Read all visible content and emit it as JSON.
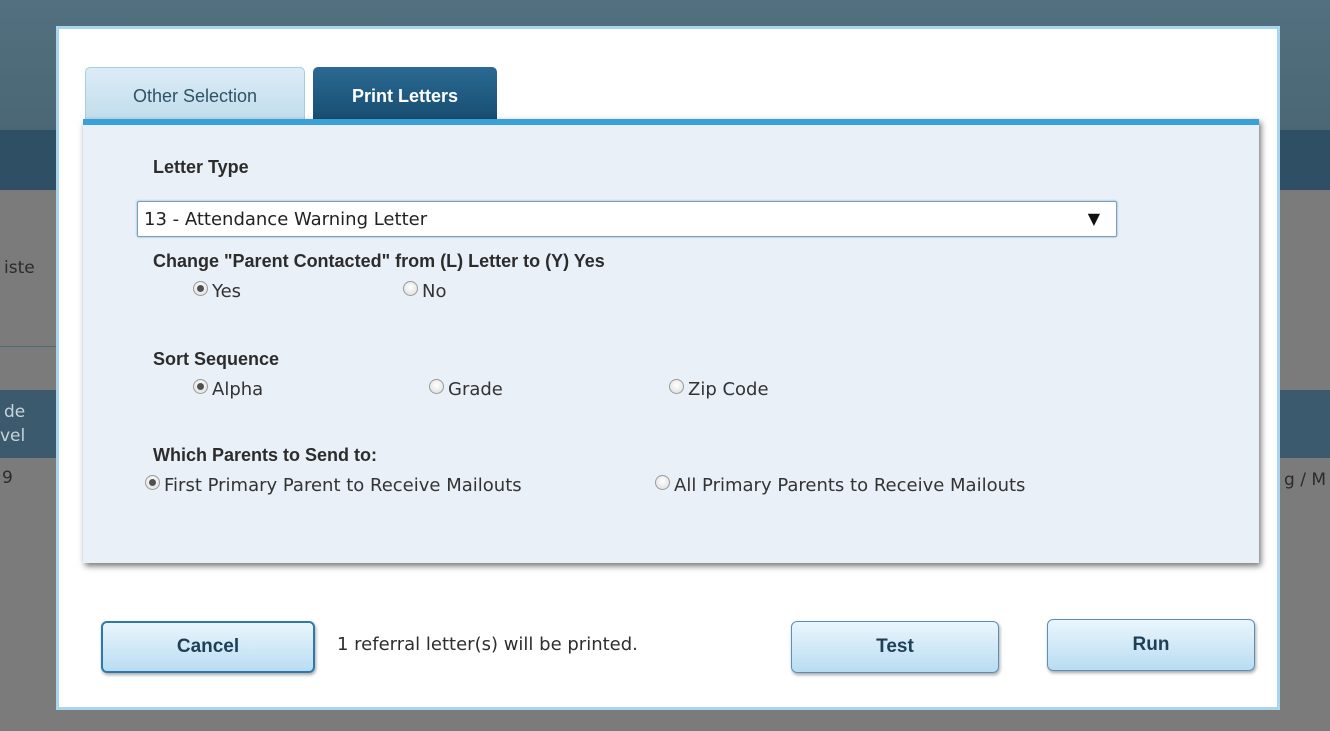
{
  "background": {
    "partial_texts": [
      "iste",
      "de",
      "vel",
      "9",
      "g / M"
    ]
  },
  "dialog": {
    "tabs": [
      {
        "label": "Other Selection"
      },
      {
        "label": "Print Letters"
      }
    ],
    "letter_type": {
      "label": "Letter Type",
      "selected": "13 - Attendance Warning Letter"
    },
    "parent_contacted": {
      "label": "Change \"Parent Contacted\" from (L) Letter to (Y) Yes",
      "options": [
        "Yes",
        "No"
      ],
      "selected": "Yes"
    },
    "sort_sequence": {
      "label": "Sort Sequence",
      "options": [
        "Alpha",
        "Grade",
        "Zip Code"
      ],
      "selected": "Alpha"
    },
    "which_parents": {
      "label": "Which Parents to Send to:",
      "options": [
        "First Primary Parent to Receive Mailouts",
        "All Primary Parents to Receive Mailouts"
      ],
      "selected": "First Primary Parent to Receive Mailouts"
    },
    "buttons": {
      "cancel": "Cancel",
      "test": "Test",
      "run": "Run"
    },
    "status": "1 referral letter(s) will be printed."
  },
  "colors": {
    "tab_active": "#1a5479",
    "panel_accent": "#3aa0d8",
    "panel_bg": "#eaf0f8",
    "overlay_bg": "#7b7b7b"
  }
}
